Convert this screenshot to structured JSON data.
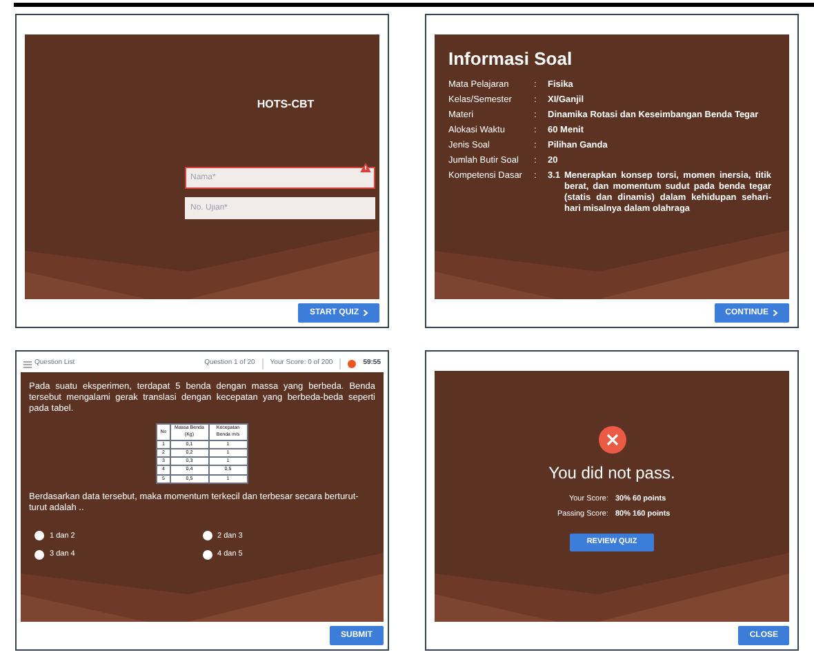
{
  "login": {
    "title": "HOTS-CBT",
    "fields": [
      {
        "placeholder": "Nama*",
        "error": true
      },
      {
        "placeholder": "No. Ujian*",
        "error": false
      }
    ],
    "button": "START QUIZ"
  },
  "info": {
    "heading": "Informasi Soal",
    "rows": [
      {
        "label": "Mata Pelajaran",
        "separator": ":",
        "value": "Fisika"
      },
      {
        "label": "Kelas/Semester",
        "separator": ":",
        "value": "XI/Ganjil"
      },
      {
        "label": "Materi",
        "separator": ":",
        "value": "Dinamika Rotasi dan Keseimbangan Benda Tegar"
      },
      {
        "label": "Alokasi Waktu",
        "separator": ":",
        "value": "60 Menit"
      },
      {
        "label": "Jenis Soal",
        "separator": ":",
        "value": "Pilihan Ganda"
      },
      {
        "label": "Jumlah Butir Soal",
        "separator": ":",
        "value": "20"
      },
      {
        "label": "Kompetensi Dasar",
        "separator": ":",
        "number": "3.1",
        "value": "Menerapkan konsep torsi, momen inersia, titik berat, dan momentum sudut pada benda tegar (statis dan dinamis) dalam kehidupan sehari-hari misalnya dalam olahraga"
      }
    ],
    "button": "CONTINUE"
  },
  "quiz": {
    "question_list": "Question List",
    "progress": "Question 1 of 20",
    "score": "Your Score: 0 of 200",
    "timer": "59:55",
    "question": "Pada suatu eksperimen, terdapat 5 benda dengan massa yang berbeda. Benda tersebut mengalami gerak translasi dengan kecepatan yang berbeda-beda seperti pada tabel.",
    "table": {
      "columns": [
        "No",
        "Massa Benda (Kg)",
        "Kecepatan Benda m/s"
      ],
      "rows": [
        [
          "1",
          "0,1",
          "1"
        ],
        [
          "2",
          "0,2",
          "1"
        ],
        [
          "3",
          "0,3",
          "1"
        ],
        [
          "4",
          "0,4",
          "0,5"
        ],
        [
          "5",
          "0,5",
          "1"
        ]
      ]
    },
    "prompt": "Berdasarkan data tersebut, maka momentum terkecil dan terbesar secara berturut-turut adalah ..",
    "options": [
      {
        "label": "1 dan 2",
        "selected": false
      },
      {
        "label": "2 dan 3",
        "selected": false
      },
      {
        "label": "3 dan 4",
        "selected": false
      },
      {
        "label": "4 dan 5",
        "selected": false
      }
    ],
    "button": "SUBMIT"
  },
  "result": {
    "message": "You did not pass.",
    "scores": [
      {
        "label": "Your Score:",
        "value": "30% 60 points"
      },
      {
        "label": "Passing Score:",
        "value": "80% 160 points"
      }
    ],
    "review_button": "REVIEW QUIZ",
    "close_button": "CLOSE"
  }
}
